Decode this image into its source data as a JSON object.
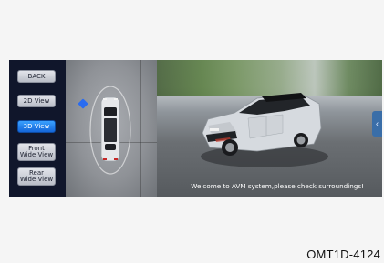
{
  "sidebar": {
    "buttons": [
      {
        "label": "BACK"
      },
      {
        "label": "2D View"
      },
      {
        "label": "3D View"
      },
      {
        "label": "Front\nWide View"
      },
      {
        "label": "Rear\nWide View"
      }
    ],
    "active_index": 2
  },
  "views": {
    "message": "Welcome to AVM system,please check surroundings!",
    "collapse_glyph": "‹"
  },
  "figure": {
    "code": "OMT1D-4124"
  },
  "icons": {
    "tab_icon": "chevron-left-icon"
  },
  "colors": {
    "active_button": "#1e7ef0",
    "car_body": "#d9dde2",
    "car_roof": "#1b1b1b",
    "car_accent": "#c73a2c"
  }
}
